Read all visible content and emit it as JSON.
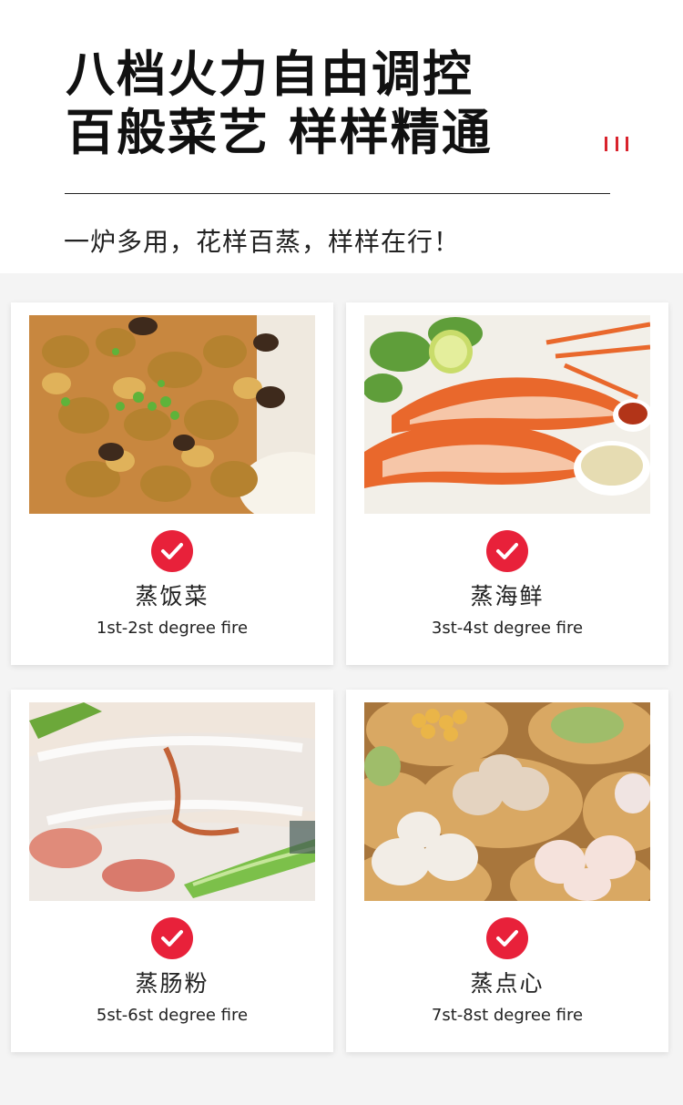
{
  "header": {
    "title_line1": "八档火力自由调控",
    "title_line2": "百般菜艺 样样精通",
    "subtitle": "一炉多用，花样百蒸，样样在行！"
  },
  "colors": {
    "accent": "#e8213a",
    "deco": "#d9232d",
    "panel_bg": "#f4f4f4"
  },
  "cards": [
    {
      "name": "蒸饭菜",
      "fire": "1st-2st degree fire",
      "icon": "check-icon",
      "photo": "steamed-rice-dish-photo"
    },
    {
      "name": "蒸海鲜",
      "fire": "3st-4st degree fire",
      "icon": "check-icon",
      "photo": "steamed-seafood-photo"
    },
    {
      "name": "蒸肠粉",
      "fire": "5st-6st degree fire",
      "icon": "check-icon",
      "photo": "rice-noodle-roll-photo"
    },
    {
      "name": "蒸点心",
      "fire": "7st-8st degree fire",
      "icon": "check-icon",
      "photo": "dim-sum-photo"
    }
  ]
}
